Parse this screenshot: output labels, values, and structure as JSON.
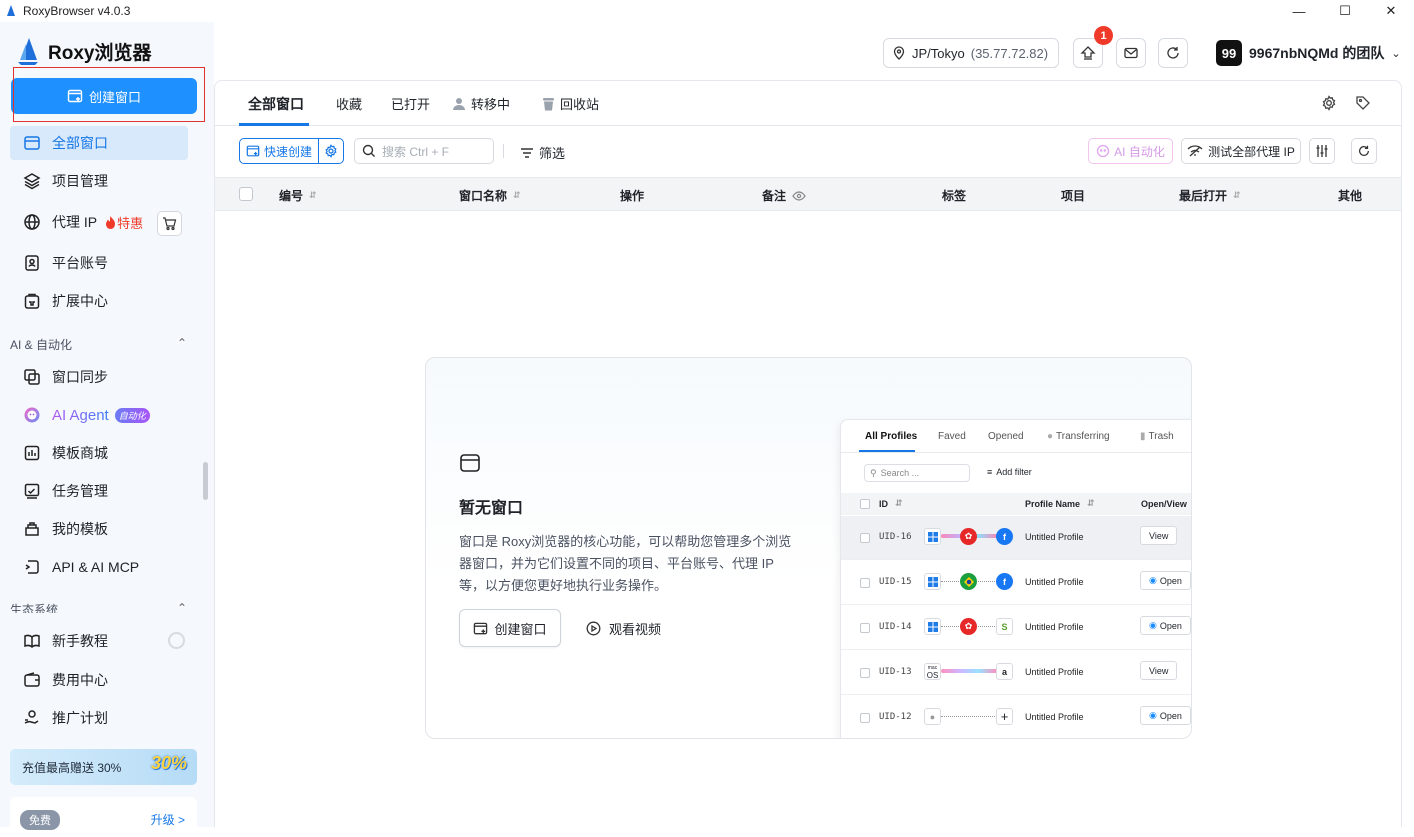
{
  "window": {
    "title": "RoxyBrowser v4.0.3"
  },
  "app": {
    "name": "Roxy浏览器"
  },
  "sidebar": {
    "create_label": "创建窗口",
    "items": [
      {
        "label": "全部窗口",
        "icon": "window-icon"
      },
      {
        "label": "项目管理",
        "icon": "layers-icon"
      },
      {
        "label": "代理 IP",
        "icon": "globe-icon",
        "hot": "特惠"
      },
      {
        "label": "平台账号",
        "icon": "account-icon"
      },
      {
        "label": "扩展中心",
        "icon": "extension-icon"
      }
    ],
    "section_ai": "AI & 自动化",
    "ai_items": [
      {
        "label": "窗口同步",
        "icon": "sync-icon"
      },
      {
        "label": "AI Agent",
        "badge": "自动化",
        "icon": "ai-agent-icon"
      },
      {
        "label": "模板商城",
        "icon": "store-icon"
      },
      {
        "label": "任务管理",
        "icon": "task-icon"
      },
      {
        "label": "我的模板",
        "icon": "template-icon"
      },
      {
        "label": "API & AI MCP",
        "icon": "api-icon"
      }
    ],
    "section_eco": "生态系统",
    "eco_items": [
      {
        "label": "新手教程",
        "icon": "book-icon"
      },
      {
        "label": "费用中心",
        "icon": "wallet-icon"
      },
      {
        "label": "推广计划",
        "icon": "promo-icon"
      }
    ],
    "promo": {
      "text": "充值最高赠送 30%",
      "graphic": "30%"
    },
    "plan": {
      "label": "免费",
      "upgrade": "升级 >"
    }
  },
  "header": {
    "location": "JP/Tokyo",
    "ip": "(35.77.72.82)",
    "notification_count": "1",
    "team_avatar": "99",
    "team_name": "9967nbNQMd 的团队"
  },
  "tabs": [
    {
      "label": "全部窗口"
    },
    {
      "label": "收藏"
    },
    {
      "label": "已打开"
    },
    {
      "label": "转移中"
    },
    {
      "label": "回收站"
    }
  ],
  "toolbar": {
    "quick_create": "快速创建",
    "search_placeholder": "搜索 Ctrl + F",
    "filter": "筛选",
    "ai_automation": "AI 自动化",
    "test_proxy": "测试全部代理 IP"
  },
  "table": {
    "columns": [
      "编号",
      "窗口名称",
      "操作",
      "备注",
      "标签",
      "项目",
      "最后打开",
      "其他"
    ]
  },
  "empty": {
    "title": "暂无窗口",
    "description": "窗口是 Roxy浏览器的核心功能，可以帮助您管理多个浏览器窗口，并为它们设置不同的项目、平台账号、代理 IP 等，以方便您更好地执行业务操作。",
    "create": "创建窗口",
    "video": "观看视频"
  },
  "preview": {
    "tabs": [
      "All Profiles",
      "Faved",
      "Opened",
      "Transferring",
      "Trash"
    ],
    "search": "Search ...",
    "filter": "Add filter",
    "headers": [
      "ID",
      "Profile Name",
      "Open/View"
    ],
    "rows": [
      {
        "uid": "UID-16",
        "name": "Untitled Profile",
        "action": "View"
      },
      {
        "uid": "UID-15",
        "name": "Untitled Profile",
        "action": "Open"
      },
      {
        "uid": "UID-14",
        "name": "Untitled Profile",
        "action": "Open"
      },
      {
        "uid": "UID-13",
        "name": "Untitled Profile",
        "action": "View"
      },
      {
        "uid": "UID-12",
        "name": "Untitled Profile",
        "action": "Open"
      }
    ],
    "os13": "OS",
    "os13_small": "mac"
  }
}
